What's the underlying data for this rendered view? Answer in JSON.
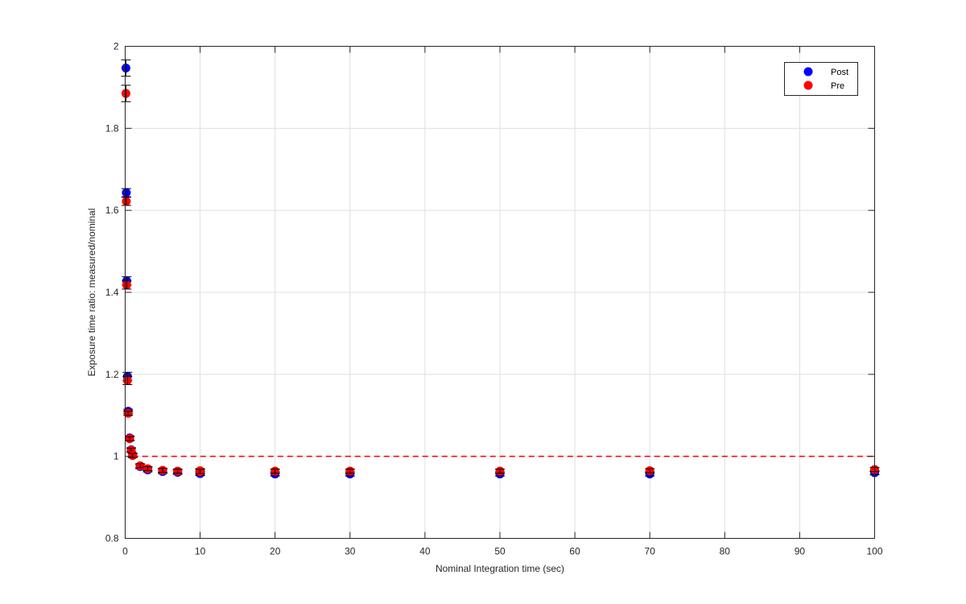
{
  "chart_data": {
    "type": "scatter",
    "title": "",
    "xlabel": "Nominal Integration time (sec)",
    "ylabel": "Exposure time ratio: measured/nominal",
    "xlim": [
      0,
      100
    ],
    "ylim": [
      0.8,
      2
    ],
    "xticks": [
      0,
      10,
      20,
      30,
      40,
      50,
      60,
      70,
      80,
      90,
      100
    ],
    "xtick_labels": [
      "0",
      "10",
      "20",
      "30",
      "40",
      "50",
      "60",
      "70",
      "80",
      "90",
      "100"
    ],
    "yticks": [
      0.8,
      1,
      1.2,
      1.4,
      1.6,
      1.8,
      2
    ],
    "ytick_labels": [
      "0.8",
      "1",
      "1.2",
      "1.4",
      "1.6",
      "1.8",
      "2"
    ],
    "grid": true,
    "legend_position": "top-right",
    "reference_line": {
      "y": 1,
      "style": "dashed",
      "color": "#ff0000"
    },
    "series": [
      {
        "name": "Post",
        "color": "#0000ff",
        "x": [
          0.1,
          0.15,
          0.2,
          0.3,
          0.4,
          0.6,
          0.8,
          1,
          2,
          3,
          5,
          7,
          10,
          10,
          20,
          30,
          50,
          70,
          100
        ],
        "y": [
          1.947,
          1.643,
          1.428,
          1.195,
          1.11,
          1.045,
          1.016,
          1.003,
          0.975,
          0.967,
          0.963,
          0.961,
          0.959,
          0.958,
          0.957,
          0.957,
          0.957,
          0.957,
          0.96
        ],
        "err": [
          0.02,
          0.01,
          0.01,
          0.01,
          0.005,
          0.005,
          0.005,
          0.005,
          0.005,
          0.005,
          0.005,
          0.005,
          0.005,
          0.005,
          0.005,
          0.005,
          0.005,
          0.005,
          0.005
        ]
      },
      {
        "name": "Pre",
        "color": "#ff0000",
        "x": [
          0.1,
          0.15,
          0.2,
          0.3,
          0.4,
          0.6,
          0.8,
          1,
          2,
          3,
          5,
          7,
          10,
          10,
          20,
          30,
          50,
          70,
          100
        ],
        "y": [
          1.885,
          1.622,
          1.418,
          1.185,
          1.105,
          1.043,
          1.015,
          1.002,
          0.977,
          0.97,
          0.966,
          0.964,
          0.965,
          0.963,
          0.964,
          0.964,
          0.964,
          0.965,
          0.968
        ],
        "err": [
          0.02,
          0.01,
          0.01,
          0.01,
          0.005,
          0.005,
          0.005,
          0.005,
          0.005,
          0.005,
          0.005,
          0.005,
          0.005,
          0.005,
          0.005,
          0.005,
          0.005,
          0.005,
          0.005
        ]
      }
    ]
  }
}
